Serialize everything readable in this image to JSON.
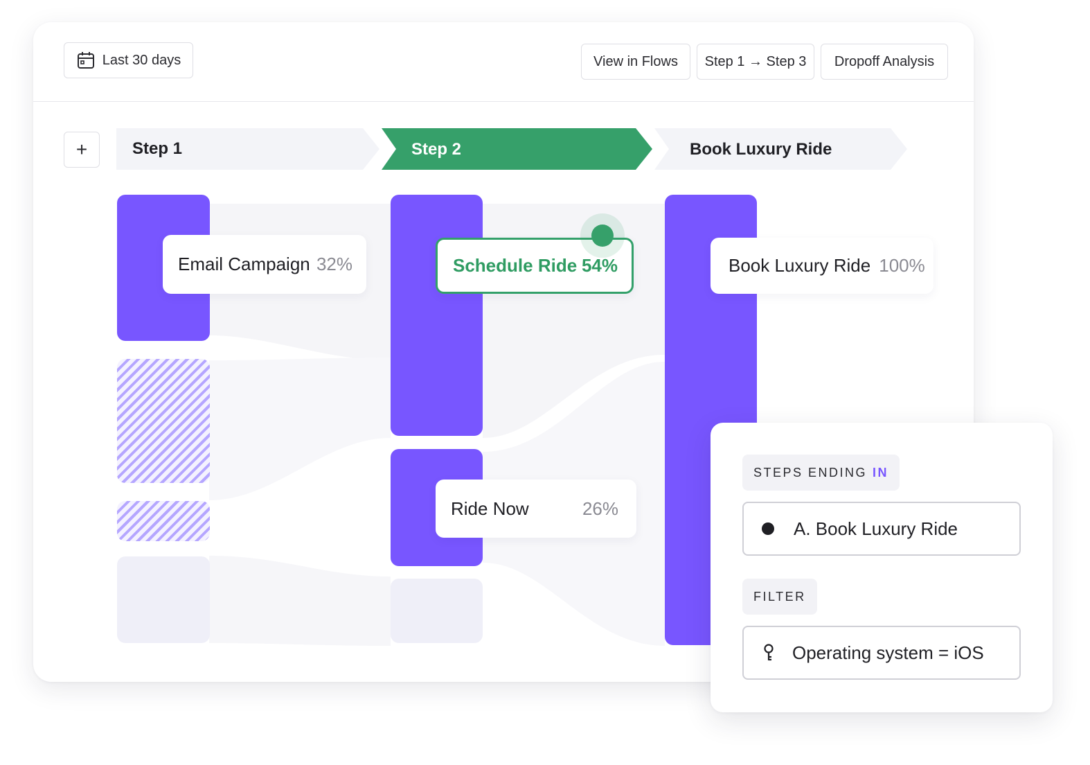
{
  "toolbar": {
    "date_range_label": "Last 30 days",
    "view_in_flows_label": "View in Flows",
    "step_range_label": "Step 1 → Step 3",
    "dropoff_analysis_label": "Dropoff Analysis"
  },
  "steps": {
    "add_label": "+",
    "tabs": [
      {
        "label": "Step 1",
        "active": false
      },
      {
        "label": "Step 2",
        "active": true
      },
      {
        "label": "Book Luxury Ride",
        "active": false
      }
    ]
  },
  "flow": {
    "columns": [
      {
        "nodes": [
          {
            "name": "Email Campaign",
            "percent": "32%"
          }
        ]
      },
      {
        "nodes": [
          {
            "name": "Schedule Ride",
            "percent": "54%",
            "selected": true
          },
          {
            "name": "Ride Now",
            "percent": "26%"
          }
        ]
      },
      {
        "nodes": [
          {
            "name": "Book Luxury Ride",
            "percent": "100%"
          }
        ]
      }
    ]
  },
  "panel": {
    "steps_ending_label": "STEPS ENDING",
    "steps_ending_accent": "IN",
    "step_value": "A. Book Luxury Ride",
    "filter_label": "FILTER",
    "filter_value": "Operating system = iOS"
  },
  "colors": {
    "accent_purple": "#7856ff",
    "active_green": "#36a06a",
    "tab_inactive": "#f3f4f8"
  },
  "icons": {
    "date": "calendar-icon",
    "step_bullet": "dot-icon",
    "filter": "key-icon",
    "add": "plus-icon",
    "arrow": "arrow-right-icon"
  }
}
